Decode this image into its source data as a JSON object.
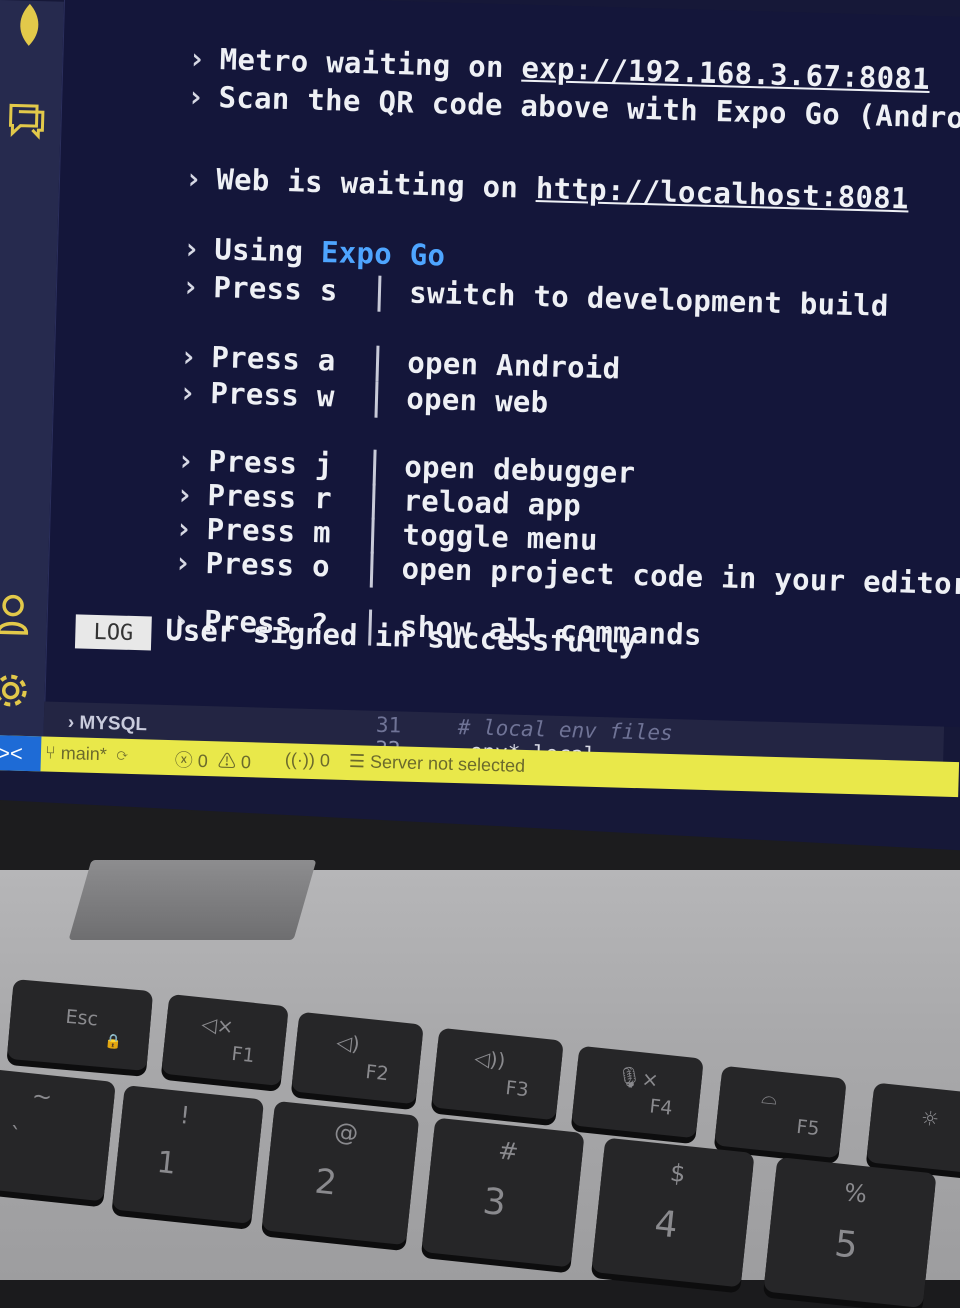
{
  "terminal": {
    "metro_prefix": "Metro waiting on ",
    "metro_url": "exp://192.168.3.67:8081",
    "scan_line": "Scan the QR code above with Expo Go (Android) o",
    "web_prefix": "Web is waiting on ",
    "web_url": "http://localhost:8081",
    "using_prefix": "Using ",
    "using_value": "Expo Go",
    "commands": [
      {
        "key": "Press s",
        "desc": "switch to development build"
      },
      {
        "key": "Press a",
        "desc": "open Android"
      },
      {
        "key": "Press w",
        "desc": "open web"
      },
      {
        "key": "Press j",
        "desc": "open debugger"
      },
      {
        "key": "Press r",
        "desc": "reload app"
      },
      {
        "key": "Press m",
        "desc": "toggle menu"
      },
      {
        "key": "Press o",
        "desc": "open project code in your editor"
      },
      {
        "key": "Press ?",
        "desc": "show all commands"
      }
    ],
    "log_badge": "LOG",
    "log_message": "User signed in successfully"
  },
  "panel": {
    "mysql_label": "MYSQL",
    "editor_lines": [
      {
        "number": "31",
        "text": "# local env files"
      },
      {
        "number": "32",
        "text": ".env*.local"
      }
    ]
  },
  "status_bar": {
    "branch": "main*",
    "errors": "0",
    "warnings": "0",
    "ports": "0",
    "server": "Server not selected"
  },
  "keyboard": {
    "row1": [
      {
        "label": "Esc",
        "sub": ""
      },
      {
        "label": "F1",
        "sub": ""
      },
      {
        "label": "F2",
        "sub": ""
      },
      {
        "label": "F3",
        "sub": ""
      },
      {
        "label": "F4",
        "sub": ""
      },
      {
        "label": "F5",
        "sub": ""
      }
    ],
    "row2": [
      {
        "top": "~",
        "bottom": "`"
      },
      {
        "top": "!",
        "bottom": "1"
      },
      {
        "top": "@",
        "bottom": "2"
      },
      {
        "top": "#",
        "bottom": "3"
      },
      {
        "top": "$",
        "bottom": "4"
      },
      {
        "top": "%",
        "bottom": "5"
      }
    ]
  },
  "colors": {
    "terminal_bg": "#14163a",
    "status_bar": "#e9e84a",
    "remote_button": "#1e6bd6",
    "expo_go_blue": "#4ea5ff",
    "activity_icons": "#e2c94a"
  }
}
